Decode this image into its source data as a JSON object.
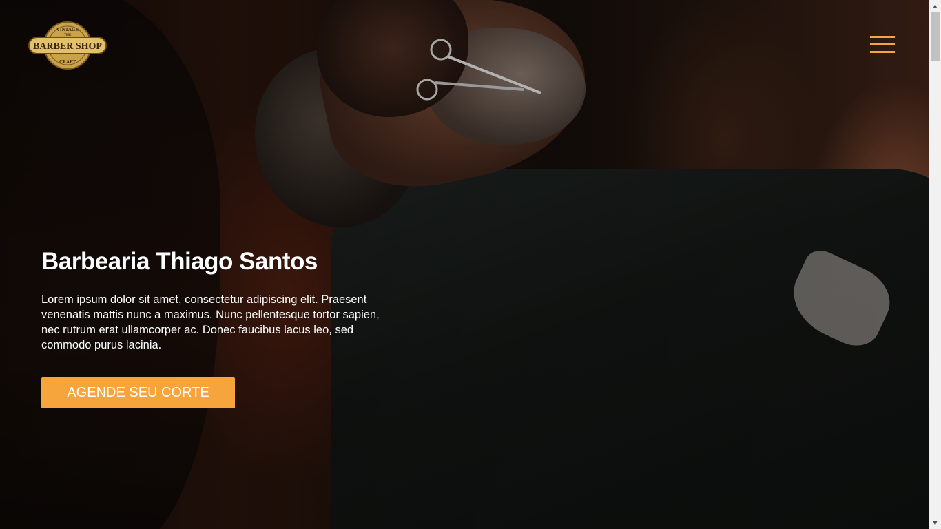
{
  "header": {
    "logo": {
      "top_text": "VINTAGE",
      "mid_text": "THE",
      "main_text": "BARBER SHOP",
      "bottom_text": "CRAFT"
    },
    "menu_icon": "hamburger-icon",
    "accent_color": "#f5a53c"
  },
  "hero": {
    "title": "Barbearia Thiago Santos",
    "description": "Lorem ipsum dolor sit amet, consectetur adipiscing elit. Praesent venenatis mattis nunc a maximus. Nunc pellentesque tortor sapien, nec rutrum erat ullamcorper ac. Donec faucibus lacus leo, sed commodo purus lacinia.",
    "cta_label": "AGENDE SEU CORTE",
    "background": "barber-trimming-beard-photo"
  },
  "scrollbar": {
    "up_icon": "scroll-up-arrow-icon",
    "down_icon": "scroll-down-arrow-icon"
  }
}
